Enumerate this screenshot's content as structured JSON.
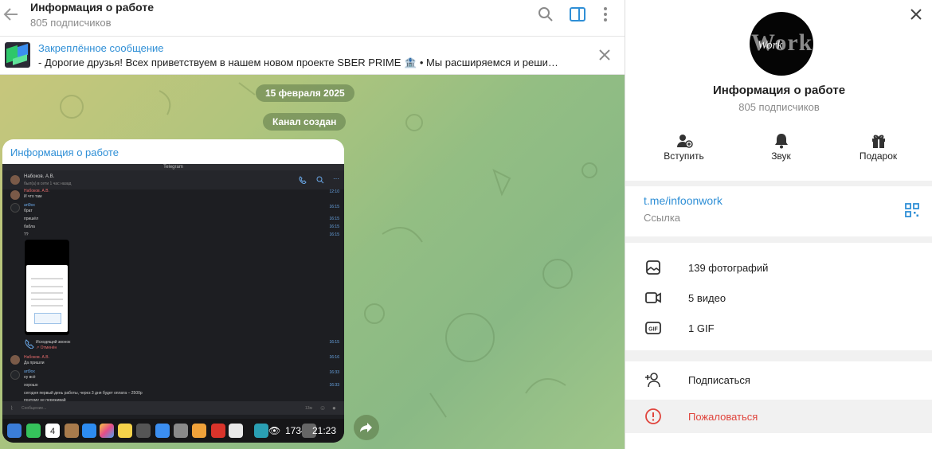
{
  "chat": {
    "title": "Информация о работе",
    "subscribers": "805 подписчиков",
    "pinned": {
      "title": "Закреплённое сообщение",
      "text": "- Дорогие друзья!  Всех приветствуем в нашем новом проекте SBER PRIME 🏦  • Мы расширяемся и реши…"
    },
    "date_pill": "15 февраля 2025",
    "service_pill": "Канал создан",
    "message": {
      "author": "Информация о работе",
      "screenshot": {
        "window_title": "Telegram",
        "contact_name": "Набоков. А.В.",
        "contact_status": "был(а) в сети 1 час назад",
        "rows": [
          {
            "name": "Набоков. А.В.",
            "text": "И что там",
            "time": "12:10"
          },
          {
            "name": "art9ox",
            "text": "брат",
            "time": "16:15"
          },
          {
            "name": "",
            "text": "пришёл",
            "time": "16:15"
          },
          {
            "name": "",
            "text": "бабла",
            "time": "16:15"
          },
          {
            "name": "",
            "text": "??",
            "time": "16:15"
          }
        ],
        "call_title": "Исходящий звонок",
        "call_status": "↗ Отменён",
        "call_time": "16:15",
        "rows2": [
          {
            "name": "Набоков. А.В.",
            "text": "Да пришли",
            "time": "16:16"
          },
          {
            "name": "art9ox",
            "text": "ну всё",
            "time": "16:33"
          },
          {
            "name": "",
            "text": "хорошо",
            "time": "16:33"
          },
          {
            "name": "",
            "text": "сегодня первый день работы, через 3 дня будет оплата – 2500р",
            "time": ""
          },
          {
            "name": "",
            "text": "поэтому не переживай",
            "time": "16:33"
          }
        ],
        "composer_placeholder": "Сообщение...",
        "composer_meta": "13м",
        "dock_calendar_day": "4",
        "dock_counter": "1734",
        "dock_time": "21:23"
      }
    }
  },
  "profile": {
    "avatar_word": "Work",
    "avatar_script": "Work",
    "name": "Информация о работе",
    "subscribers": "805 подписчиков",
    "actions": [
      {
        "label": "Вступить",
        "icon": "join-icon"
      },
      {
        "label": "Звук",
        "icon": "bell-icon"
      },
      {
        "label": "Подарок",
        "icon": "gift-icon"
      }
    ],
    "link": "t.me/infoonwork",
    "link_caption": "Ссылка",
    "media": [
      {
        "label": "139 фотографий",
        "icon": "photo-icon"
      },
      {
        "label": "5 видео",
        "icon": "video-icon"
      },
      {
        "label": "1 GIF",
        "icon": "gif-icon"
      }
    ],
    "subscribe_label": "Подписаться",
    "report_label": "Пожаловаться"
  },
  "colors": {
    "accent": "#2f8fd6",
    "danger": "#e0443c",
    "panel_bg": "#f1f1f1",
    "chat_bg": "#9fc282"
  }
}
